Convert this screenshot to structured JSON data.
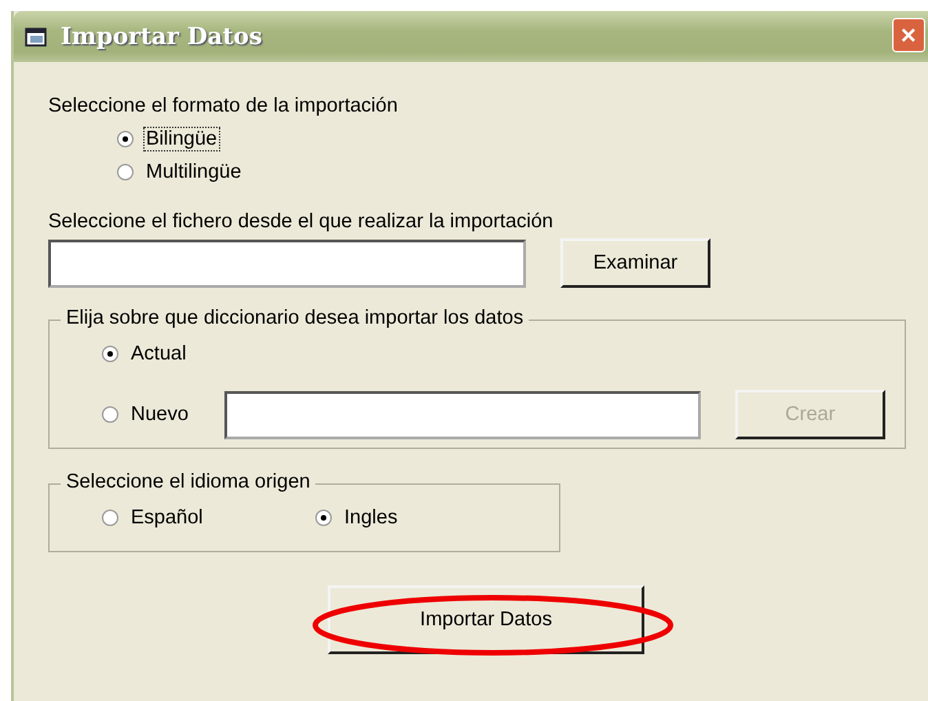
{
  "window": {
    "title": "Importar Datos",
    "close": "✕"
  },
  "format": {
    "label": "Seleccione el formato de la importación",
    "options": [
      {
        "label": "Bilingüe",
        "selected": true,
        "focused": true
      },
      {
        "label": "Multilingüe",
        "selected": false,
        "focused": false
      }
    ]
  },
  "file": {
    "label": "Seleccione el fichero desde el que realizar la importación",
    "button": "Examinar"
  },
  "dictionary": {
    "legend": "Elija sobre que diccionario desea importar los datos",
    "options": [
      {
        "label": "Actual",
        "selected": true
      },
      {
        "label": "Nuevo",
        "selected": false
      }
    ],
    "create_button": {
      "label": "Crear",
      "disabled": true
    }
  },
  "language": {
    "legend": "Seleccione el idioma origen",
    "options": [
      {
        "label": "Español",
        "selected": false
      },
      {
        "label": "Ingles",
        "selected": true
      }
    ]
  },
  "import_button": {
    "label": "Importar Datos",
    "circled": true
  }
}
